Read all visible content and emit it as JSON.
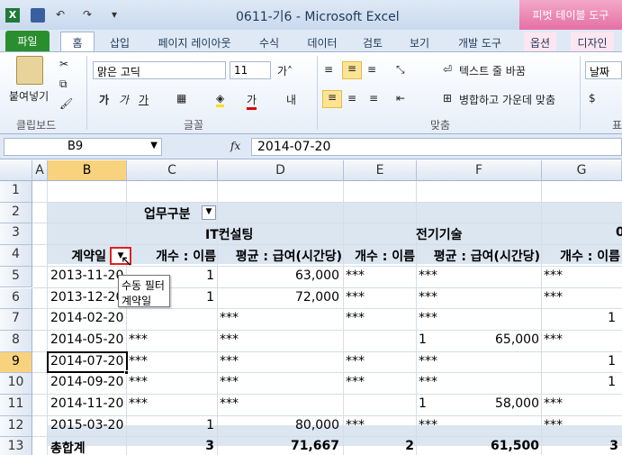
{
  "title_bar": {
    "doc_title": "0611-기6  -  Microsoft Excel",
    "contextual_tab": "피벗 테이블 도구"
  },
  "tabs": [
    "파일",
    "홈",
    "삽입",
    "페이지 레이아웃",
    "수식",
    "데이터",
    "검토",
    "보기",
    "개발 도구",
    "옵션",
    "디자인"
  ],
  "ribbon": {
    "paste_label": "붙여넣기",
    "font_name": "맑은 고딕",
    "font_size": "11",
    "wrap_text": "텍스트 줄 바꿈",
    "merge_center": "병합하고 가운데 맞춤",
    "number_format": "날짜",
    "group_clipboard": "클립보드",
    "group_font": "글꼴",
    "group_align": "맞춤",
    "group_number": "표"
  },
  "formula_bar": {
    "name_box": "B9",
    "fx": "fx",
    "formula": "2014-07-20"
  },
  "columns": [
    "A",
    "B",
    "C",
    "D",
    "E",
    "F",
    "G"
  ],
  "rows": [
    "1",
    "2",
    "3",
    "4",
    "5",
    "6",
    "7",
    "8",
    "9",
    "10",
    "11",
    "12",
    "13"
  ],
  "pivot": {
    "col_field": "업무구분",
    "group1": "IT컨설팅",
    "group2": "전기기술",
    "group3_partial": "0",
    "row_field": "계약일",
    "h_count": "개수 : 이름",
    "h_avg": "평균 : 급여(시간당)",
    "rows": [
      {
        "date": "2013-11-20",
        "c": "1",
        "d": "63,000",
        "e": "***",
        "f_l": "***",
        "f": "",
        "g": "***",
        "h": ""
      },
      {
        "date": "2013-12-20",
        "c": "1",
        "d": "72,000",
        "e": "***",
        "f_l": "***",
        "f": "",
        "g": "***",
        "h": ""
      },
      {
        "date": "2014-02-20",
        "c": "",
        "d_l": "***",
        "d": "",
        "e": "***",
        "f_l": "***",
        "f": "",
        "g": "",
        "h": "1"
      },
      {
        "date": "2014-05-20",
        "c_l": "***",
        "c": "",
        "d_l": "***",
        "d": "",
        "e": "",
        "f_l": "1",
        "f": "65,000",
        "g": "***",
        "h": ""
      },
      {
        "date": "2014-07-20",
        "c_l": "***",
        "c": "",
        "d_l": "***",
        "d": "",
        "e": "***",
        "f_l": "***",
        "f": "",
        "g": "",
        "h": "1"
      },
      {
        "date": "2014-09-20",
        "c_l": "***",
        "c": "",
        "d_l": "***",
        "d": "",
        "e": "***",
        "f_l": "***",
        "f": "",
        "g": "",
        "h": "1"
      },
      {
        "date": "2014-11-20",
        "c_l": "***",
        "c": "",
        "d_l": "***",
        "d": "",
        "e": "",
        "f_l": "1",
        "f": "58,000",
        "g": "***",
        "h": ""
      },
      {
        "date": "2015-03-20",
        "c": "1",
        "d": "80,000",
        "e": "***",
        "f_l": "***",
        "f": "",
        "g": "***",
        "h": ""
      }
    ],
    "total_label": "총합계",
    "total_c": "3",
    "total_d": "71,667",
    "total_e": "2",
    "total_f": "61,500",
    "total_g": "3"
  },
  "tooltip": {
    "title": "수동 필터",
    "subtitle": "계약일"
  },
  "colors": {
    "accent": "#2a8e2f",
    "pivot_band": "#dce6f1",
    "selected_header": "#f9d27d",
    "contextual": "#e56fa5",
    "filter_highlight": "#e02020"
  }
}
